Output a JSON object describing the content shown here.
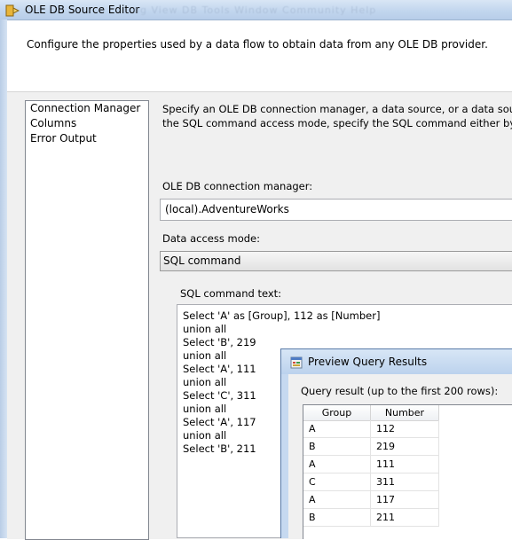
{
  "window": {
    "title": "OLE DB Source Editor",
    "background_menu_text": "ng  View  DB  Tools  Window  Community  Help"
  },
  "header": {
    "description": "Configure the properties used by a data flow to obtain data from any OLE DB provider."
  },
  "nav": {
    "items": [
      {
        "label": "Connection Manager"
      },
      {
        "label": "Columns"
      },
      {
        "label": "Error Output"
      }
    ]
  },
  "main": {
    "description_line1": "Specify an OLE DB connection manager, a data source, or a data source vie",
    "description_line2": "the SQL command access mode, specify the SQL command either by typin",
    "connection_label": "OLE DB connection manager:",
    "connection_value": "(local).AdventureWorks",
    "access_mode_label": "Data access mode:",
    "access_mode_value": "SQL command",
    "sql_label": "SQL command text:",
    "sql_lines": [
      "Select 'A' as [Group], 112 as [Number]",
      "union all",
      "Select 'B', 219",
      "union all",
      "Select 'A', 111",
      "union all",
      "Select 'C', 311",
      "union all",
      "Select 'A', 117",
      "union all",
      "Select 'B', 211"
    ]
  },
  "preview": {
    "title": "Preview Query Results",
    "result_label": "Query result (up to the first 200 rows):",
    "columns": [
      "Group",
      "Number"
    ],
    "rows": [
      [
        "A",
        "112"
      ],
      [
        "B",
        "219"
      ],
      [
        "A",
        "111"
      ],
      [
        "C",
        "311"
      ],
      [
        "A",
        "117"
      ],
      [
        "B",
        "211"
      ]
    ]
  }
}
